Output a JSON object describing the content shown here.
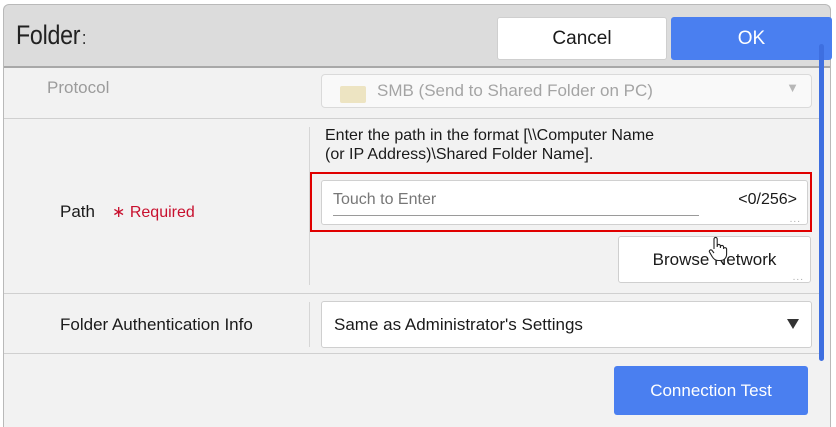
{
  "dialog": {
    "title": "Folder",
    "title_suffix": ":",
    "cancel_label": "Cancel",
    "ok_label": "OK"
  },
  "protocol": {
    "label": "Protocol",
    "value": "SMB (Send to Shared Folder on PC)",
    "icon": "folder-icon"
  },
  "path": {
    "label": "Path",
    "required_label": "∗ Required",
    "hint_line1": "Enter the path in the format [\\\\Computer Name",
    "hint_line2": "(or IP Address)\\Shared Folder Name].",
    "input_placeholder": "Touch to Enter",
    "input_value": "",
    "counter": "<0/256>",
    "more_indicator": "...",
    "browse_label": "Browse Network"
  },
  "auth": {
    "label": "Folder Authentication Info",
    "selected": "Same as Administrator's Settings"
  },
  "connection_test_label": "Connection Test",
  "colors": {
    "accent": "#4a7ff0",
    "required": "#c8102e",
    "highlight_box": "#e00000",
    "header_bg": "#dcdcdc",
    "content_bg": "#f2f2f2"
  }
}
